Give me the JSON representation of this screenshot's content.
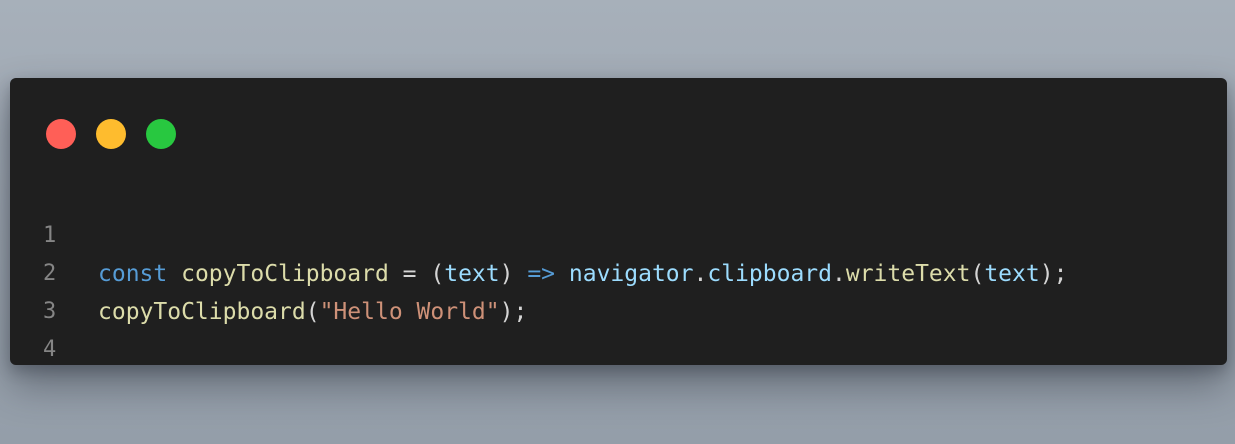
{
  "window": {
    "buttons": [
      {
        "name": "close",
        "color": "#ff5f57"
      },
      {
        "name": "minimize",
        "color": "#febc2e"
      },
      {
        "name": "maximize",
        "color": "#28c840"
      }
    ]
  },
  "code": {
    "line_numbers": [
      "1",
      "2",
      "3",
      "4"
    ],
    "line1": {
      "const": "const",
      "space1": " ",
      "fn_name": "copyToClipboard",
      "eq": " = (",
      "param": "text",
      "close_paren": ") ",
      "arrow": "=>",
      "space2": " ",
      "navigator": "navigator",
      "dot1": ".",
      "clipboard": "clipboard",
      "dot2": ".",
      "method": "writeText",
      "open2": "(",
      "arg": "text",
      "end": ");"
    },
    "line2": {
      "fn_call": "copyToClipboard",
      "open": "(",
      "string": "\"Hello World\"",
      "end": ");"
    }
  }
}
